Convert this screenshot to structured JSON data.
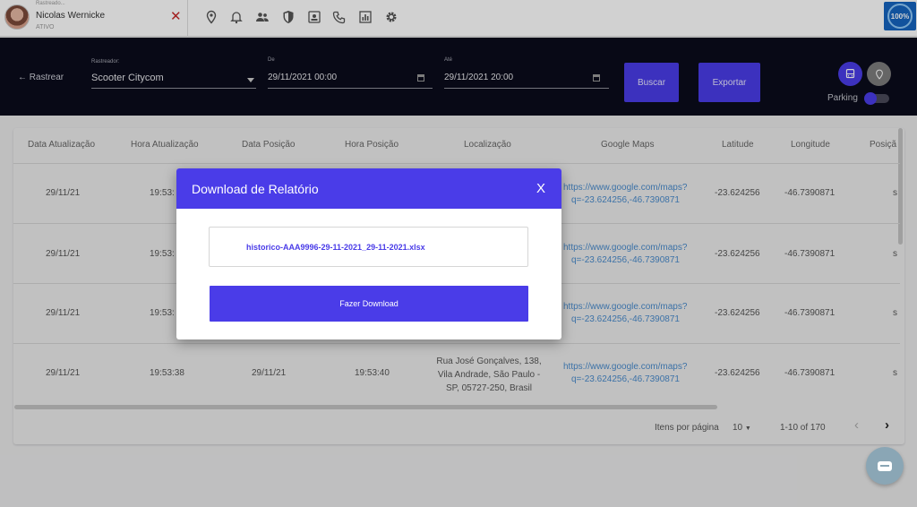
{
  "topbar": {
    "user_sub": "Rastreado...",
    "user_name": "Nicolas Wernicke",
    "user_status": "ATIVO",
    "close": "✕",
    "icons": [
      "location-pin-icon",
      "bell-icon",
      "people-icon",
      "shield-icon",
      "id-card-icon",
      "phone-icon",
      "chart-icon",
      "gear-icon"
    ],
    "battery": "100%"
  },
  "header": {
    "back_label": "Rastrear",
    "tracker_label": "Rastreador:",
    "tracker_value": "Scooter Citycom",
    "from_label": "De",
    "from_value": "29/11/2021 00:00",
    "to_label": "Até",
    "to_value": "29/11/2021 20:00",
    "search_btn": "Buscar",
    "export_btn": "Exportar",
    "parking_label": "Parking"
  },
  "table": {
    "columns": [
      "Data Atualização",
      "Hora Atualização",
      "Data Posição",
      "Hora Posição",
      "Localização",
      "Google Maps",
      "Latitude",
      "Longitude",
      "Posiçã"
    ],
    "rows": [
      {
        "date": "29/11/21",
        "time": "19:53:",
        "pos_date": "",
        "pos_time": "",
        "location": "",
        "maps1": "https://www.google.com/maps?",
        "maps2": "q=-23.624256,-46.7390871",
        "lat": "-23.624256",
        "lng": "-46.7390871",
        "pos": "s"
      },
      {
        "date": "29/11/21",
        "time": "19:53:",
        "pos_date": "",
        "pos_time": "",
        "location": "",
        "maps1": "https://www.google.com/maps?",
        "maps2": "q=-23.624256,-46.7390871",
        "lat": "-23.624256",
        "lng": "-46.7390871",
        "pos": "s"
      },
      {
        "date": "29/11/21",
        "time": "19:53:",
        "pos_date": "",
        "pos_time": "",
        "location": "",
        "maps1": "https://www.google.com/maps?",
        "maps2": "q=-23.624256,-46.7390871",
        "lat": "-23.624256",
        "lng": "-46.7390871",
        "pos": "s"
      },
      {
        "date": "29/11/21",
        "time": "19:53:38",
        "pos_date": "29/11/21",
        "pos_time": "19:53:40",
        "loc1": "Rua José Gonçalves, 138,",
        "loc2": "Vila Andrade, São Paulo -",
        "loc3": "SP, 05727-250, Brasil",
        "maps1": "https://www.google.com/maps?",
        "maps2": "q=-23.624256,-46.7390871",
        "lat": "-23.624256",
        "lng": "-46.7390871",
        "pos": "s"
      }
    ],
    "per_page_label": "Itens por página",
    "per_page_value": "10",
    "range": "1-10 of 170",
    "prev": "‹",
    "next": "›"
  },
  "modal": {
    "title": "Download de Relatório",
    "close": "X",
    "filename": "historico-AAA9996-29-11-2021_29-11-2021.xlsx",
    "download_btn": "Fazer Download"
  }
}
